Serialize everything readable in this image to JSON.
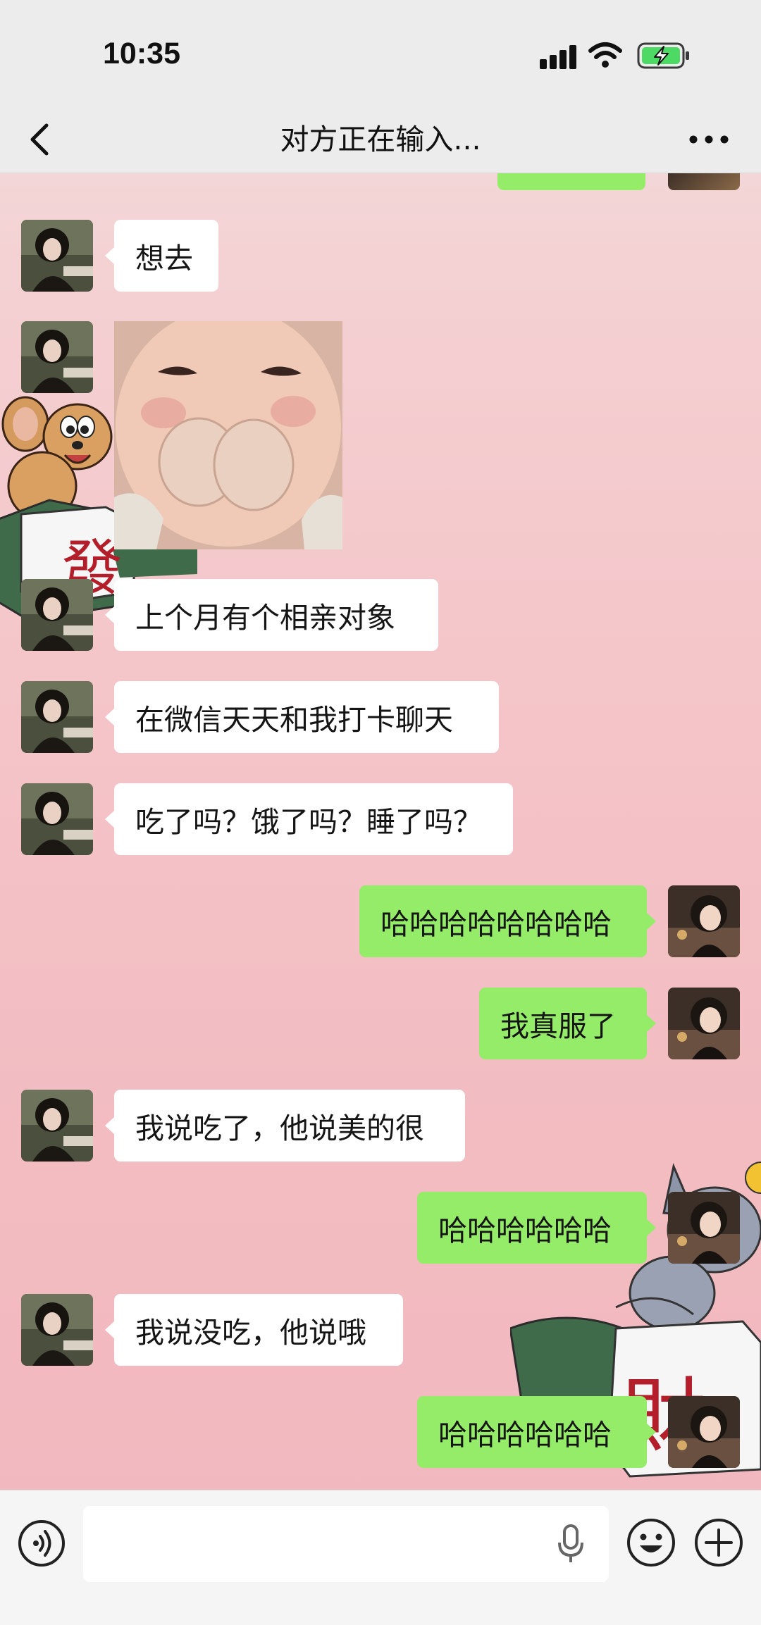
{
  "status_bar": {
    "time": "10:35"
  },
  "nav": {
    "title": "对方正在输入..."
  },
  "messages": [
    {
      "dir": "in",
      "type": "text",
      "text": "想去"
    },
    {
      "dir": "in",
      "type": "sticker",
      "sticker": "baby-grinning-sticker"
    },
    {
      "dir": "in",
      "type": "text",
      "text": "上个月有个相亲对象"
    },
    {
      "dir": "in",
      "type": "text",
      "text": "在微信天天和我打卡聊天"
    },
    {
      "dir": "in",
      "type": "text",
      "text": "吃了吗？饿了吗？睡了吗？"
    },
    {
      "dir": "out",
      "type": "text",
      "text": "哈哈哈哈哈哈哈哈"
    },
    {
      "dir": "out",
      "type": "text",
      "text": "我真服了"
    },
    {
      "dir": "in",
      "type": "text",
      "text": "我说吃了，他说美的很"
    },
    {
      "dir": "out",
      "type": "text",
      "text": "哈哈哈哈哈哈"
    },
    {
      "dir": "in",
      "type": "text",
      "text": "我说没吃，他说哦"
    },
    {
      "dir": "out",
      "type": "text",
      "text": "哈哈哈哈哈哈"
    }
  ],
  "decorations": {
    "left_tile_char": "發",
    "right_tile_char": "財"
  },
  "icons": [
    "back-icon",
    "more-icon",
    "voice-icon",
    "mic-icon",
    "emoji-icon",
    "plus-icon",
    "signal-icon",
    "wifi-icon",
    "battery-charging-icon"
  ],
  "colors": {
    "outgoing_bubble": "#95ec69",
    "incoming_bubble": "#ffffff",
    "battery": "#4cd964"
  }
}
